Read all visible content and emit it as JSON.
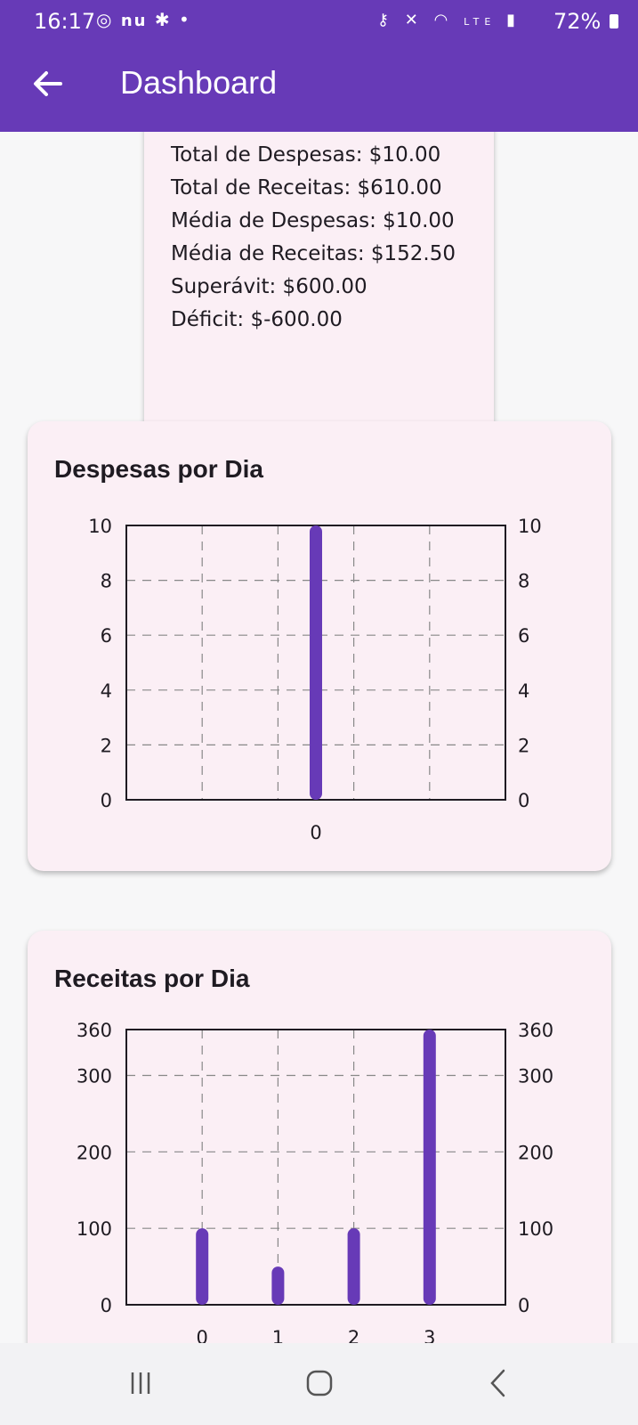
{
  "status_bar": {
    "time": "16:17",
    "left_icons": [
      "whatsapp-icon",
      "nubank-icon",
      "app-icon",
      "dot-icon"
    ],
    "right_icons": [
      "key-icon",
      "mute-icon",
      "wifi-icon",
      "volte-icon",
      "signal-icon"
    ],
    "battery": "72%"
  },
  "app_bar": {
    "title": "Dashboard",
    "back_icon": "arrow-back-icon",
    "color": "#673ab7"
  },
  "summary": {
    "lines": [
      "Total de Despesas: $10.00",
      "Total de Receitas: $610.00",
      "Média de Despesas: $10.00",
      "Média de Receitas: $152.50",
      "Superávit: $600.00",
      "Déficit: $-600.00"
    ]
  },
  "chart_data": [
    {
      "type": "bar",
      "title": "Despesas por Dia",
      "categories": [
        "0"
      ],
      "values": [
        10
      ],
      "ylim": [
        0,
        10
      ],
      "yticks": [
        0,
        2,
        4,
        6,
        8,
        10
      ],
      "y_axis_both_sides": true,
      "grid": true,
      "grid_style": "dashed",
      "bar_color": "#673ab7"
    },
    {
      "type": "bar",
      "title": "Receitas por Dia",
      "categories": [
        "0",
        "1",
        "2",
        "3"
      ],
      "values": [
        100,
        50,
        100,
        360
      ],
      "ylim": [
        0,
        360
      ],
      "yticks": [
        0,
        100,
        200,
        300,
        360
      ],
      "y_axis_both_sides": true,
      "grid": true,
      "grid_style": "dashed",
      "bar_color": "#673ab7"
    }
  ],
  "nav_bar": {
    "items": [
      "recent-apps-icon",
      "home-icon",
      "back-icon"
    ]
  }
}
